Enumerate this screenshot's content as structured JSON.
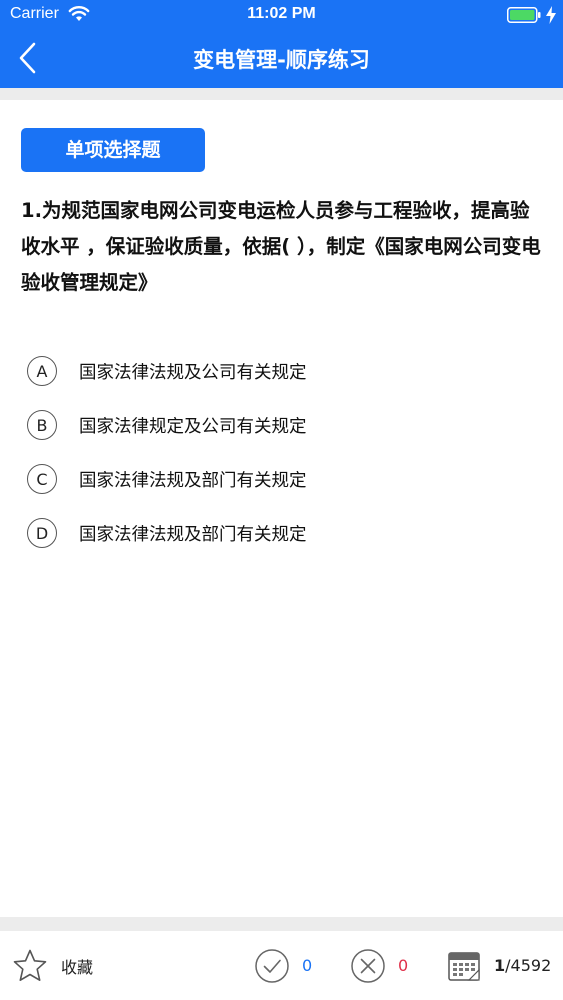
{
  "status_bar": {
    "carrier": "Carrier",
    "time": "11:02 PM"
  },
  "navbar": {
    "title": "变电管理-顺序练习",
    "back_icon": "chevron-left-icon"
  },
  "question": {
    "type_label": "单项选择题",
    "text": "1.为规范国家电网公司变电运检人员参与工程验收，提高验收水平 ，保证验收质量，依据( ），制定《国家电网公司变电验收管理规定》",
    "options": [
      {
        "letter": "A",
        "text": "国家法律法规及公司有关规定"
      },
      {
        "letter": "B",
        "text": "国家法律规定及公司有关规定"
      },
      {
        "letter": "C",
        "text": "国家法律法规及部门有关规定"
      },
      {
        "letter": "D",
        "text": "国家法律法规及部门有关规定"
      }
    ]
  },
  "bottom_bar": {
    "favorite_label": "收藏",
    "correct_count": "0",
    "wrong_count": "0",
    "current_index": "1",
    "total": "/4592"
  },
  "colors": {
    "primary": "#1a73f5",
    "correct": "#1a73f5",
    "wrong": "#e0304a",
    "separator": "#ececec"
  }
}
